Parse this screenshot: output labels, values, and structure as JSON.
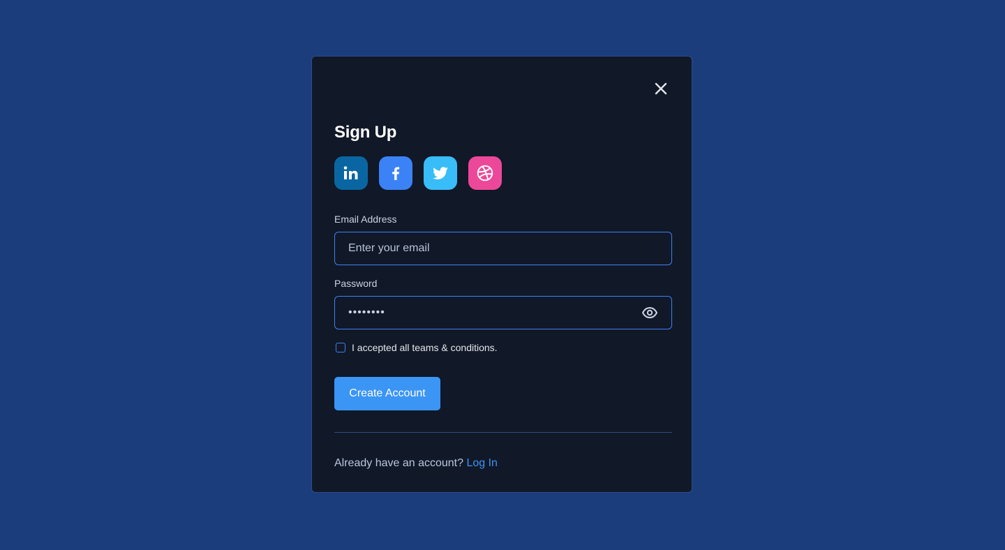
{
  "modal": {
    "title": "Sign Up",
    "close_icon": "close-icon"
  },
  "socials": [
    {
      "name": "linkedin",
      "icon": "linkedin-icon",
      "color": "#0a66a2"
    },
    {
      "name": "facebook",
      "icon": "facebook-icon",
      "color": "#3b82f6"
    },
    {
      "name": "twitter",
      "icon": "twitter-icon",
      "color": "#38bdf8"
    },
    {
      "name": "dribbble",
      "icon": "dribbble-icon",
      "color": "#ec4899"
    }
  ],
  "email": {
    "label": "Email Address",
    "placeholder": "Enter your email",
    "value": ""
  },
  "password": {
    "label": "Password",
    "value": "••••••••",
    "toggle_icon": "eye-icon"
  },
  "terms": {
    "text": "I accepted all teams & conditions.",
    "checked": false
  },
  "actions": {
    "create_label": "Create Account"
  },
  "footer": {
    "prompt": "Already have an account?",
    "login_label": "Log In"
  },
  "colors": {
    "background": "#1b3d7c",
    "modal": "#111827",
    "accent": "#3b95f5"
  }
}
